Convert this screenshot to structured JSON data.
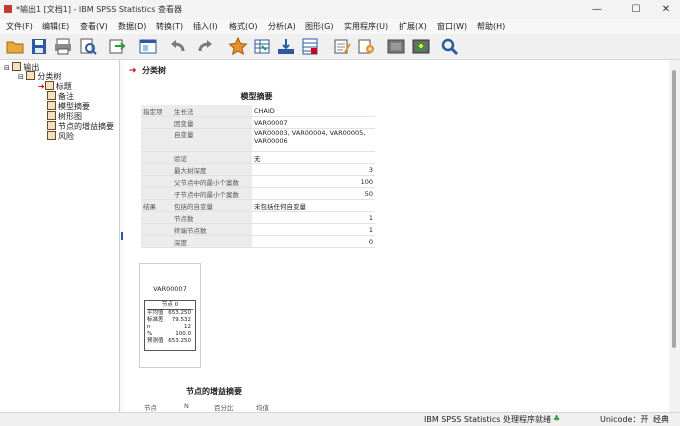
{
  "window": {
    "title": "*输出1 [文档1] - IBM SPSS Statistics 查看器",
    "controls": [
      "—",
      "☐",
      "✕"
    ]
  },
  "menu": [
    "文件(F)",
    "编辑(E)",
    "查看(V)",
    "数据(D)",
    "转换(T)",
    "插入(I)",
    "格式(O)",
    "分析(A)",
    "图形(G)",
    "实用程序(U)",
    "扩展(X)",
    "窗口(W)",
    "帮助(H)"
  ],
  "toolbar": {
    "icons": [
      "open-icon",
      "save-icon",
      "print-icon",
      "print-preview-icon",
      "export-icon",
      "recall-dialog-icon",
      "undo-icon",
      "redo-icon",
      "goto-data-icon",
      "goto-case-icon",
      "goto-variable-icon",
      "variables-icon",
      "insert-heading-icon",
      "insert-title-icon",
      "insert-text-icon",
      "show-hide-icon",
      "find-icon"
    ]
  },
  "tree": {
    "root": "输出",
    "group": "分类树",
    "items": [
      "标题",
      "备注",
      "模型摘要",
      "树形图",
      "节点的增益摘要",
      "风险"
    ]
  },
  "content": {
    "section_title": "分类树",
    "model_summary": {
      "title": "模型摘要",
      "rows": [
        {
          "group": "指定项",
          "label": "生长法",
          "value": "CHAID"
        },
        {
          "group": "",
          "label": "因变量",
          "value": "VAR00007"
        },
        {
          "group": "",
          "label": "自变量",
          "value": "VAR00003, VAR00004, VAR00005, VAR00006"
        },
        {
          "group": "",
          "label": "验证",
          "value": "无"
        },
        {
          "group": "",
          "label": "最大树深度",
          "value": "3"
        },
        {
          "group": "",
          "label": "父节点中的最小个案数",
          "value": "100"
        },
        {
          "group": "",
          "label": "子节点中的最小个案数",
          "value": "50"
        },
        {
          "group": "结果",
          "label": "包括的自变量",
          "value": "未包括任何自变量"
        },
        {
          "group": "",
          "label": "节点数",
          "value": "1"
        },
        {
          "group": "",
          "label": "终端节点数",
          "value": "1"
        },
        {
          "group": "",
          "label": "深度",
          "value": "0"
        }
      ]
    },
    "tree_diagram": {
      "dependent": "VAR00007",
      "node_header": "节点 0",
      "rows": [
        {
          "label": "平均值",
          "value": "653.250"
        },
        {
          "label": "标准差",
          "value": "79.532"
        },
        {
          "label": "n",
          "value": "12"
        },
        {
          "label": "%",
          "value": "100.0"
        },
        {
          "label": "预测值",
          "value": "653.250"
        }
      ]
    },
    "gain_summary": {
      "title": "节点的增益摘要",
      "headers": [
        "节点",
        "N",
        "百分比",
        "均值"
      ]
    }
  },
  "statusbar": {
    "processor": "IBM SPSS Statistics 处理程序就绪",
    "unicode": "Unicode：开",
    "mode": "经典"
  },
  "colors": {
    "accent_red": "#d0021b",
    "table_label_bg": "#ececec",
    "tree_icon": "#6a4a2a"
  }
}
